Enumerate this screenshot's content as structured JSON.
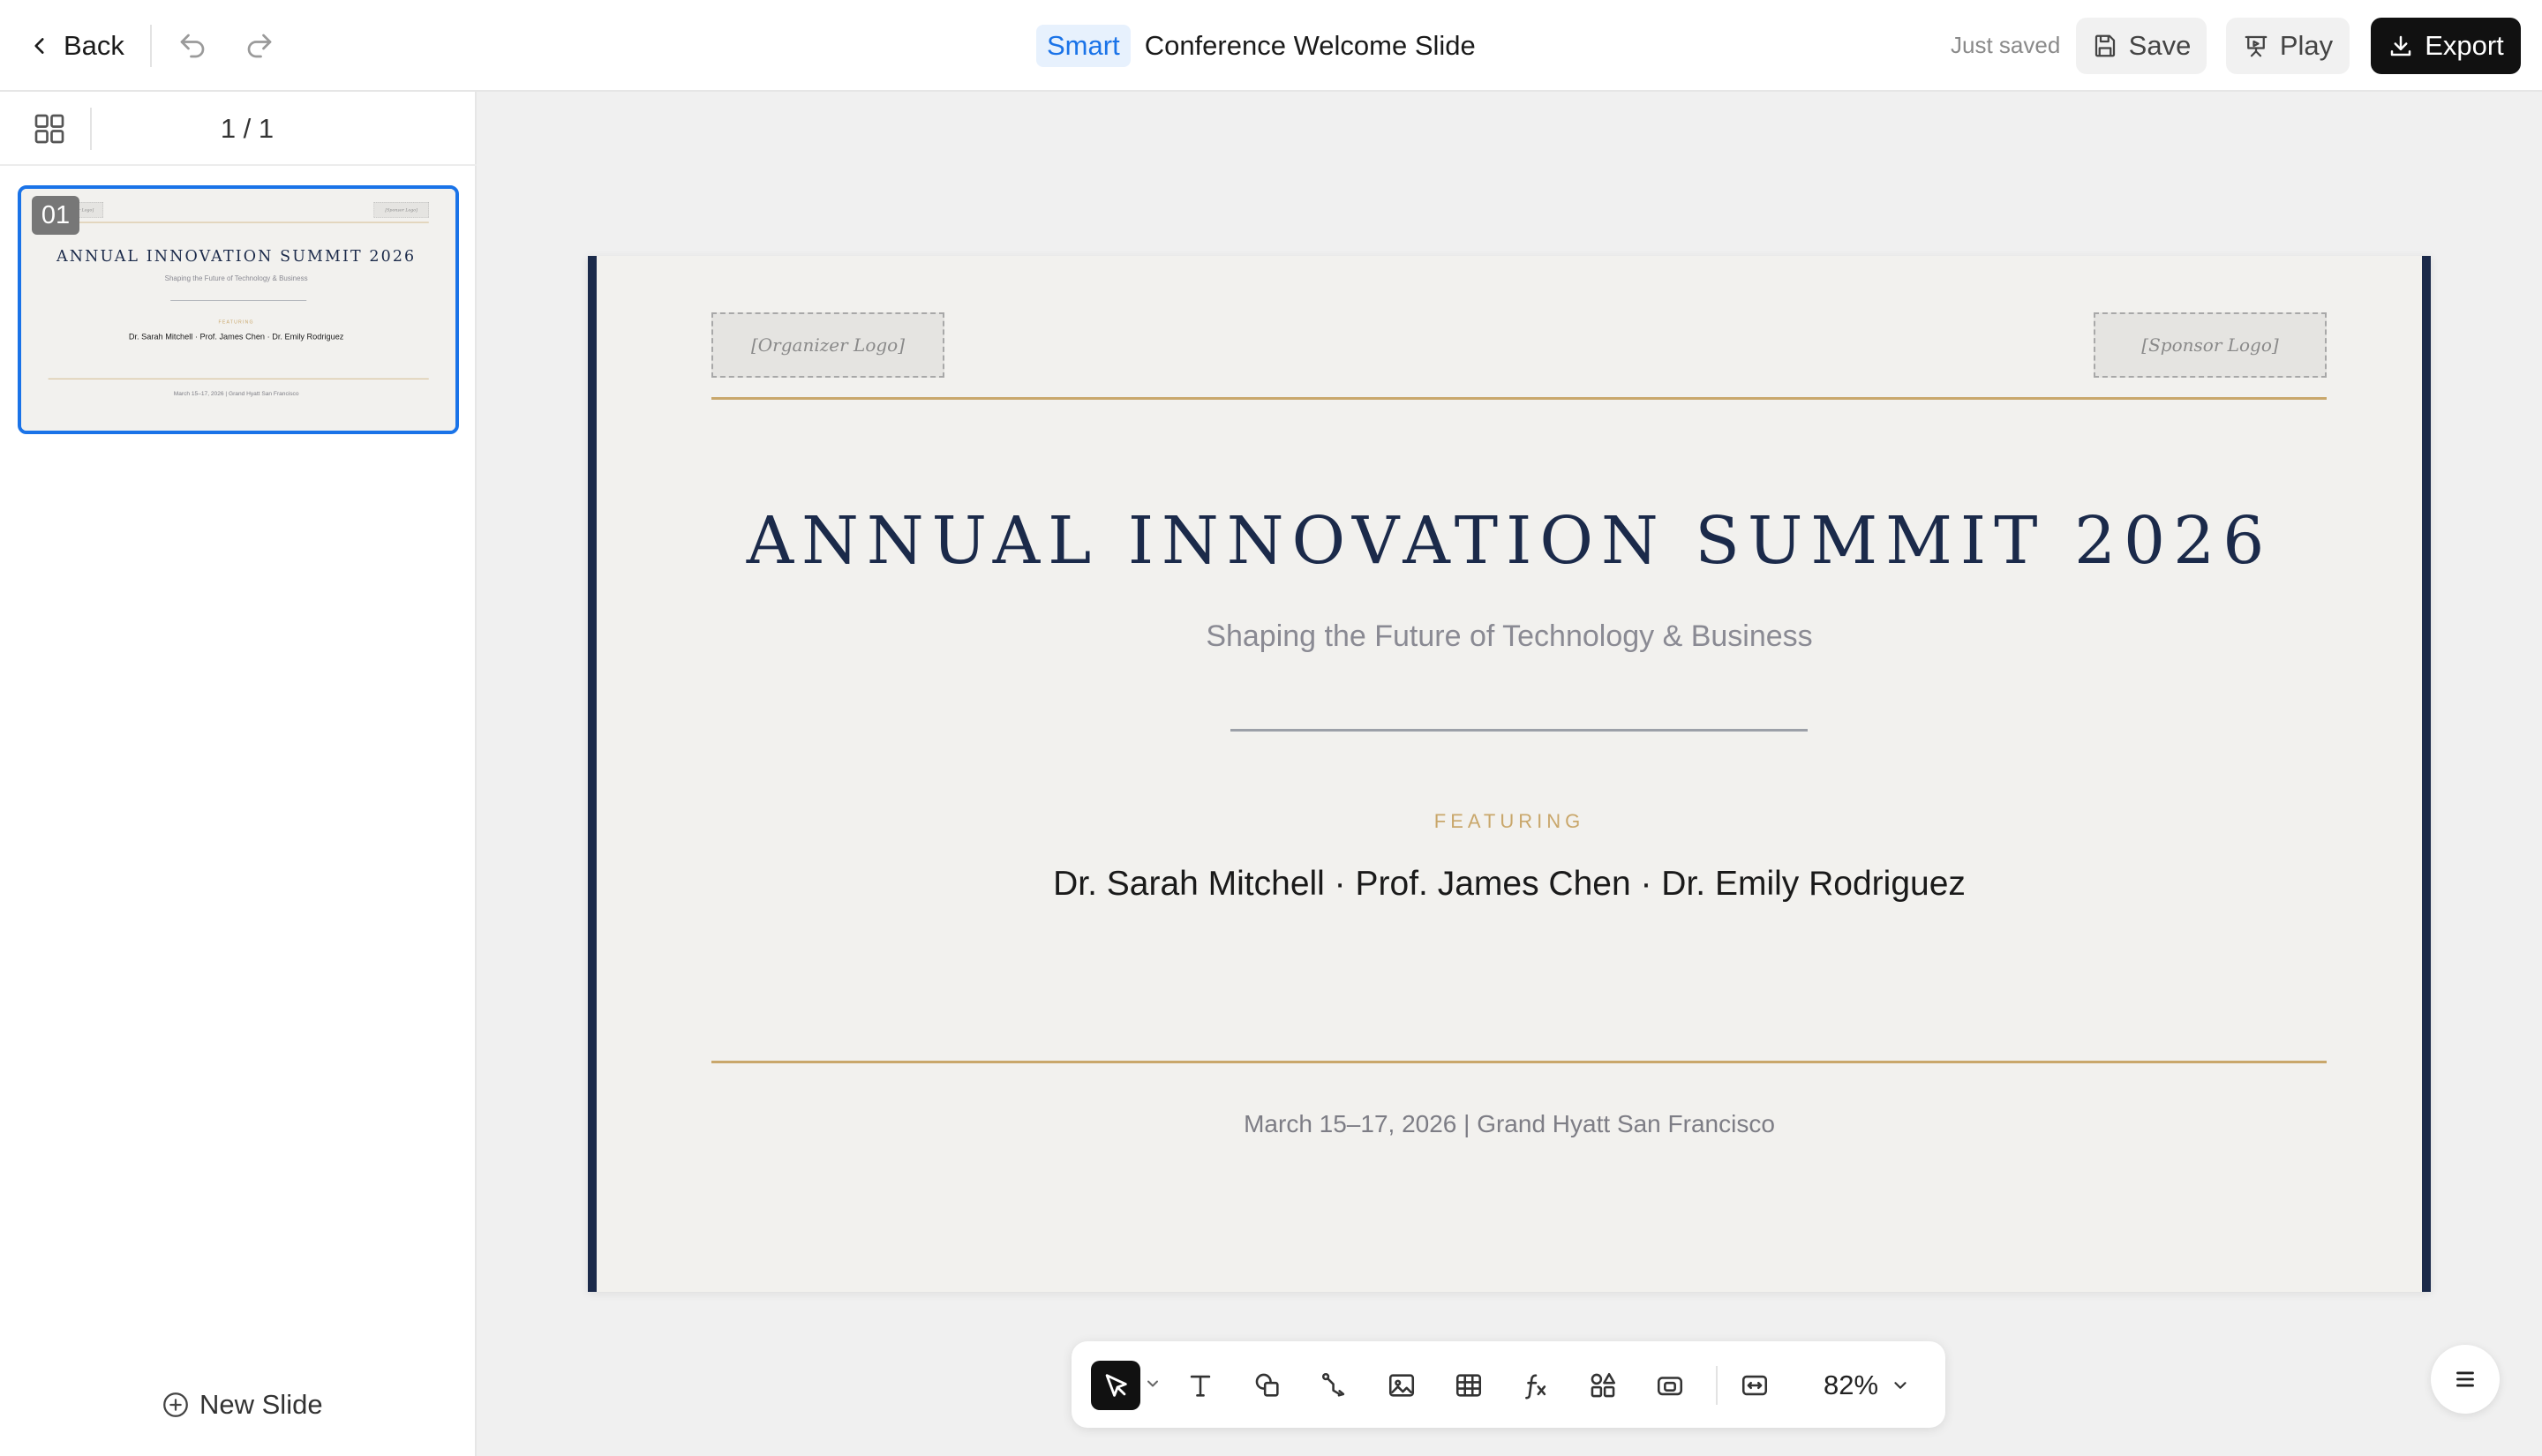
{
  "header": {
    "back_label": "Back",
    "badge": "Smart",
    "title": "Conference Welcome Slide",
    "status": "Just saved",
    "save_label": "Save",
    "play_label": "Play",
    "export_label": "Export"
  },
  "sidebar": {
    "page_count": "1 / 1",
    "new_slide_label": "New Slide",
    "slides": [
      {
        "number": "01"
      }
    ]
  },
  "slide": {
    "organizer_logo": "[Organizer Logo]",
    "sponsor_logo": "[Sponsor Logo]",
    "title": "ANNUAL INNOVATION SUMMIT 2026",
    "subtitle": "Shaping the Future of Technology & Business",
    "featuring": "FEATURING",
    "speakers": "Dr. Sarah Mitchell · Prof. James Chen · Dr. Emily Rodriguez",
    "date_venue": "March 15–17, 2026 | Grand Hyatt San Francisco"
  },
  "toolbar": {
    "zoom": "82%",
    "tools": [
      "select-tool",
      "text-tool",
      "shape-tool",
      "connector-tool",
      "image-tool",
      "table-tool",
      "formula-tool",
      "components-tool",
      "media-tool",
      "fit-tool"
    ]
  },
  "colors": {
    "accent": "#1a73e8",
    "navy": "#1b2a4a",
    "gold": "#c9a76b",
    "slide_bg": "#f2f1ee"
  }
}
